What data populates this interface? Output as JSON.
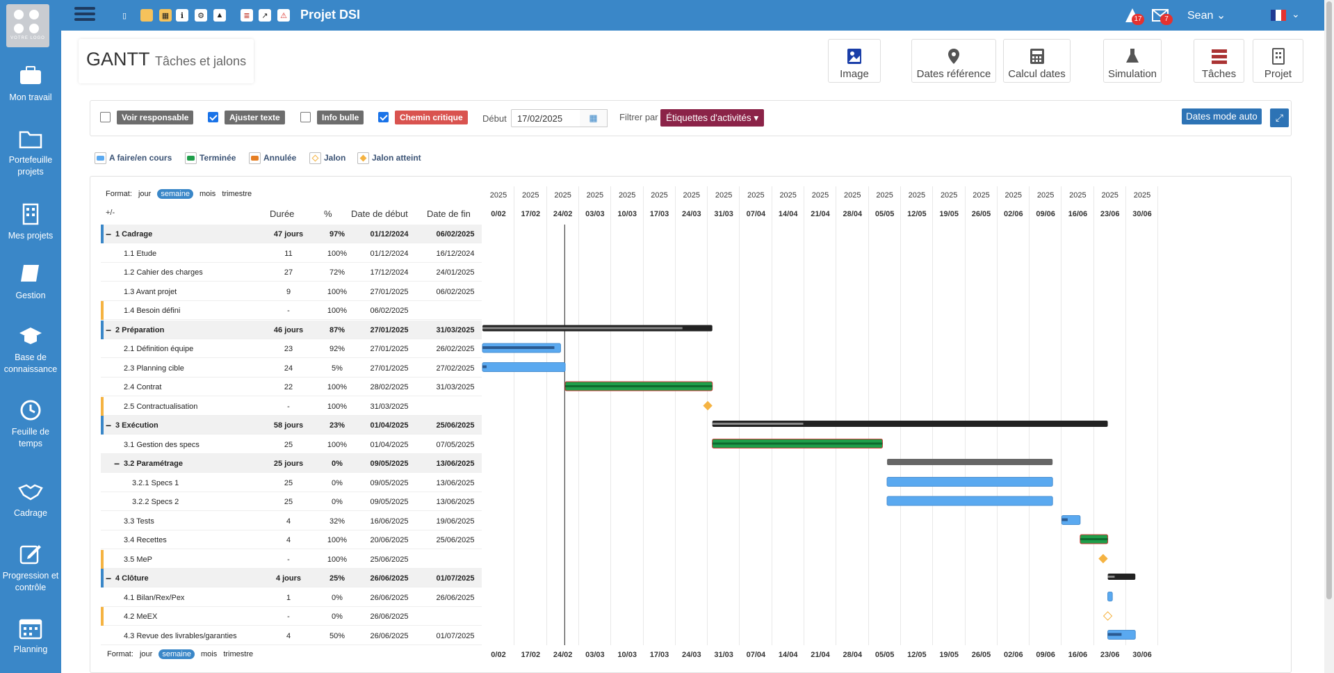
{
  "app": {
    "logo_text": "VOTRE LOGO",
    "project_title": "Projet DSI",
    "user": "Sean",
    "alerts_count": "17",
    "messages_count": "7"
  },
  "sidebar": {
    "items": [
      {
        "label": "Mon travail",
        "icon": "briefcase-icon"
      },
      {
        "label": "Portefeuille projets",
        "icon": "folder-icon"
      },
      {
        "label": "Mes projets",
        "icon": "building-icon"
      },
      {
        "label": "Gestion",
        "icon": "book-icon"
      },
      {
        "label": "Base de connaissance",
        "icon": "graduation-cap-icon"
      },
      {
        "label": "Feuille de temps",
        "icon": "clock-icon"
      },
      {
        "label": "Cadrage",
        "icon": "handshake-icon"
      },
      {
        "label": "Progression et contrôle",
        "icon": "edit-icon"
      },
      {
        "label": "Planning",
        "icon": "calendar-icon"
      }
    ]
  },
  "header": {
    "title": "GANTT",
    "subtitle": "Tâches et jalons"
  },
  "actions": [
    {
      "label": "Image",
      "icon": "image-icon"
    },
    {
      "label": "Dates référence",
      "icon": "map-pin-icon"
    },
    {
      "label": "Calcul dates",
      "icon": "calculator-icon"
    },
    {
      "label": "Simulation",
      "icon": "flask-icon"
    },
    {
      "label": "Tâches",
      "icon": "tasks-icon"
    },
    {
      "label": "Projet",
      "icon": "document-icon"
    }
  ],
  "filters": {
    "voir_responsable": "Voir responsable",
    "ajuster_texte": "Ajuster texte",
    "info_bulle": "Info bulle",
    "chemin_critique": "Chemin critique",
    "debut_label": "Début",
    "debut_value": "17/02/2025",
    "filtrer_par_label": "Filtrer par",
    "filtrer_value": "Étiquettes d'activités",
    "dates_mode_auto": "Dates mode auto"
  },
  "legend": {
    "items": [
      "A faire/en cours",
      "Terminée",
      "Annulée",
      "Jalon",
      "Jalon atteint"
    ]
  },
  "format": {
    "label": "Format:",
    "options": [
      "jour",
      "semaine",
      "mois",
      "trimestre"
    ],
    "selected": "semaine"
  },
  "table_headers": {
    "toggle": "+/-",
    "duree": "Durée",
    "pct": "%",
    "debut": "Date de début",
    "fin": "Date de fin"
  },
  "rows": [
    {
      "name": "1 Cadrage",
      "dur": "47 jours",
      "pct": "97%",
      "start": "01/12/2024",
      "end": "06/02/2025",
      "group": true,
      "level": 0
    },
    {
      "name": "1.1 Etude",
      "dur": "11",
      "pct": "100%",
      "start": "01/12/2024",
      "end": "16/12/2024",
      "level": 1
    },
    {
      "name": "1.2 Cahier des charges",
      "dur": "27",
      "pct": "72%",
      "start": "17/12/2024",
      "end": "24/01/2025",
      "level": 1
    },
    {
      "name": "1.3 Avant projet",
      "dur": "9",
      "pct": "100%",
      "start": "27/01/2025",
      "end": "06/02/2025",
      "level": 1
    },
    {
      "name": "1.4 Besoin défini",
      "dur": "-",
      "pct": "100%",
      "start": "06/02/2025",
      "end": "",
      "level": 1,
      "milestone": true
    },
    {
      "name": "2 Préparation",
      "dur": "46 jours",
      "pct": "87%",
      "start": "27/01/2025",
      "end": "31/03/2025",
      "group": true,
      "level": 0
    },
    {
      "name": "2.1 Définition équipe",
      "dur": "23",
      "pct": "92%",
      "start": "27/01/2025",
      "end": "26/02/2025",
      "level": 1
    },
    {
      "name": "2.3 Planning cible",
      "dur": "24",
      "pct": "5%",
      "start": "27/01/2025",
      "end": "27/02/2025",
      "level": 1
    },
    {
      "name": "2.4 Contrat",
      "dur": "22",
      "pct": "100%",
      "start": "28/02/2025",
      "end": "31/03/2025",
      "level": 1
    },
    {
      "name": "2.5 Contractualisation",
      "dur": "-",
      "pct": "100%",
      "start": "31/03/2025",
      "end": "",
      "level": 1,
      "milestone": true
    },
    {
      "name": "3 Exécution",
      "dur": "58 jours",
      "pct": "23%",
      "start": "01/04/2025",
      "end": "25/06/2025",
      "group": true,
      "level": 0
    },
    {
      "name": "3.1 Gestion des specs",
      "dur": "25",
      "pct": "100%",
      "start": "01/04/2025",
      "end": "07/05/2025",
      "level": 1
    },
    {
      "name": "3.2 Paramétrage",
      "dur": "25 jours",
      "pct": "0%",
      "start": "09/05/2025",
      "end": "13/06/2025",
      "group": true,
      "level": 1
    },
    {
      "name": "3.2.1 Specs 1",
      "dur": "25",
      "pct": "0%",
      "start": "09/05/2025",
      "end": "13/06/2025",
      "level": 2
    },
    {
      "name": "3.2.2 Specs 2",
      "dur": "25",
      "pct": "0%",
      "start": "09/05/2025",
      "end": "13/06/2025",
      "level": 2
    },
    {
      "name": "3.3 Tests",
      "dur": "4",
      "pct": "32%",
      "start": "16/06/2025",
      "end": "19/06/2025",
      "level": 1
    },
    {
      "name": "3.4 Recettes",
      "dur": "4",
      "pct": "100%",
      "start": "20/06/2025",
      "end": "25/06/2025",
      "level": 1
    },
    {
      "name": "3.5 MeP",
      "dur": "-",
      "pct": "100%",
      "start": "25/06/2025",
      "end": "",
      "level": 1,
      "milestone": true
    },
    {
      "name": "4 Clôture",
      "dur": "4 jours",
      "pct": "25%",
      "start": "26/06/2025",
      "end": "01/07/2025",
      "group": true,
      "level": 0
    },
    {
      "name": "4.1 Bilan/Rex/Pex",
      "dur": "1",
      "pct": "0%",
      "start": "26/06/2025",
      "end": "26/06/2025",
      "level": 1
    },
    {
      "name": "4.2 MeEX",
      "dur": "-",
      "pct": "0%",
      "start": "26/06/2025",
      "end": "",
      "level": 1,
      "milestone": true
    },
    {
      "name": "4.3 Revue des livrables/garanties",
      "dur": "4",
      "pct": "50%",
      "start": "26/06/2025",
      "end": "01/07/2025",
      "level": 1
    }
  ],
  "timeline": {
    "year": "2025",
    "weeks": [
      "0/02",
      "17/02",
      "24/02",
      "03/03",
      "10/03",
      "17/03",
      "24/03",
      "31/03",
      "07/04",
      "14/04",
      "21/04",
      "28/04",
      "05/05",
      "12/05",
      "19/05",
      "26/05",
      "02/06",
      "09/06",
      "16/06",
      "23/06",
      "30/06"
    ]
  },
  "colors": {
    "sidebar": "#3a87c8",
    "bar_todo": "#5aa9f0",
    "bar_done": "#1f9e4a",
    "summary": "#222222",
    "critical": "#d9302c",
    "milestone": "#f5b342"
  }
}
